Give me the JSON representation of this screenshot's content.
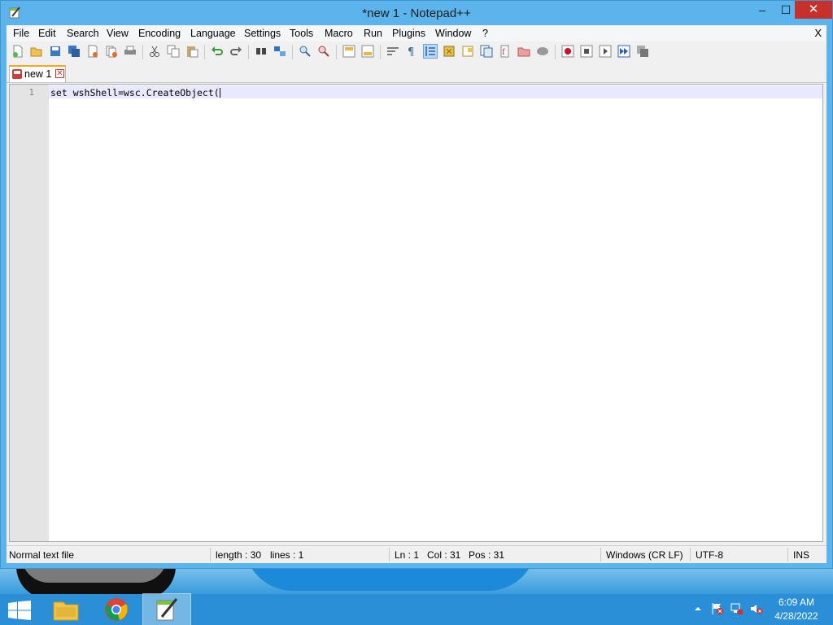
{
  "window": {
    "title": "*new 1 - Notepad++",
    "min_glyph": "–",
    "max_glyph": "☐",
    "close_glyph": "✕"
  },
  "menu": {
    "items": [
      "File",
      "Edit",
      "Search",
      "View",
      "Encoding",
      "Language",
      "Settings",
      "Tools",
      "Macro",
      "Run",
      "Plugins",
      "Window",
      "?"
    ],
    "close_doc": "X"
  },
  "toolbar": {
    "icons": [
      "new-file-icon",
      "open-file-icon",
      "save-icon",
      "save-all-icon",
      "close-icon",
      "close-all-icon",
      "print-icon",
      "cut-icon",
      "copy-icon",
      "paste-icon",
      "undo-icon",
      "redo-icon",
      "find-icon",
      "replace-icon",
      "zoom-in-icon",
      "zoom-out-icon",
      "sync-vertical-icon",
      "sync-horizontal-icon",
      "word-wrap-icon",
      "show-all-chars-icon",
      "indent-guide-icon",
      "user-language-icon",
      "doc-map-icon",
      "function-list-icon",
      "folder-workspace-icon",
      "doc-switcher-icon",
      "monitoring-icon",
      "record-macro-icon",
      "stop-macro-icon",
      "play-macro-icon",
      "run-macro-multiple-icon",
      "save-macro-icon"
    ],
    "active_icon": "indent-guide-icon"
  },
  "tabs": [
    {
      "label": "new 1",
      "modified": true
    }
  ],
  "editor": {
    "lines": [
      {
        "number": "1",
        "text": "set wshShell=wsc.CreateObject("
      }
    ]
  },
  "status": {
    "filetype": "Normal text file",
    "length": "length : 30",
    "lines": "lines : 1",
    "ln": "Ln : 1",
    "col": "Col : 31",
    "pos": "Pos : 31",
    "eol": "Windows (CR LF)",
    "encoding": "UTF-8",
    "mode": "INS"
  },
  "taskbar": {
    "apps": [
      "file-explorer",
      "chrome",
      "notepad-plus-plus"
    ],
    "active_app": "notepad-plus-plus",
    "tray_icons": [
      "show-hidden-icons-icon",
      "action-center-icon",
      "network-icon",
      "volume-muted-icon"
    ],
    "clock_time": "6:09 AM",
    "clock_date": "4/28/2022"
  },
  "colors": {
    "titlebar": "#5bb4ec",
    "close_button": "#c7312b",
    "taskbar": "#2a8fd6",
    "tab_accent": "#f6a821",
    "current_line": "#e8e8ff"
  }
}
